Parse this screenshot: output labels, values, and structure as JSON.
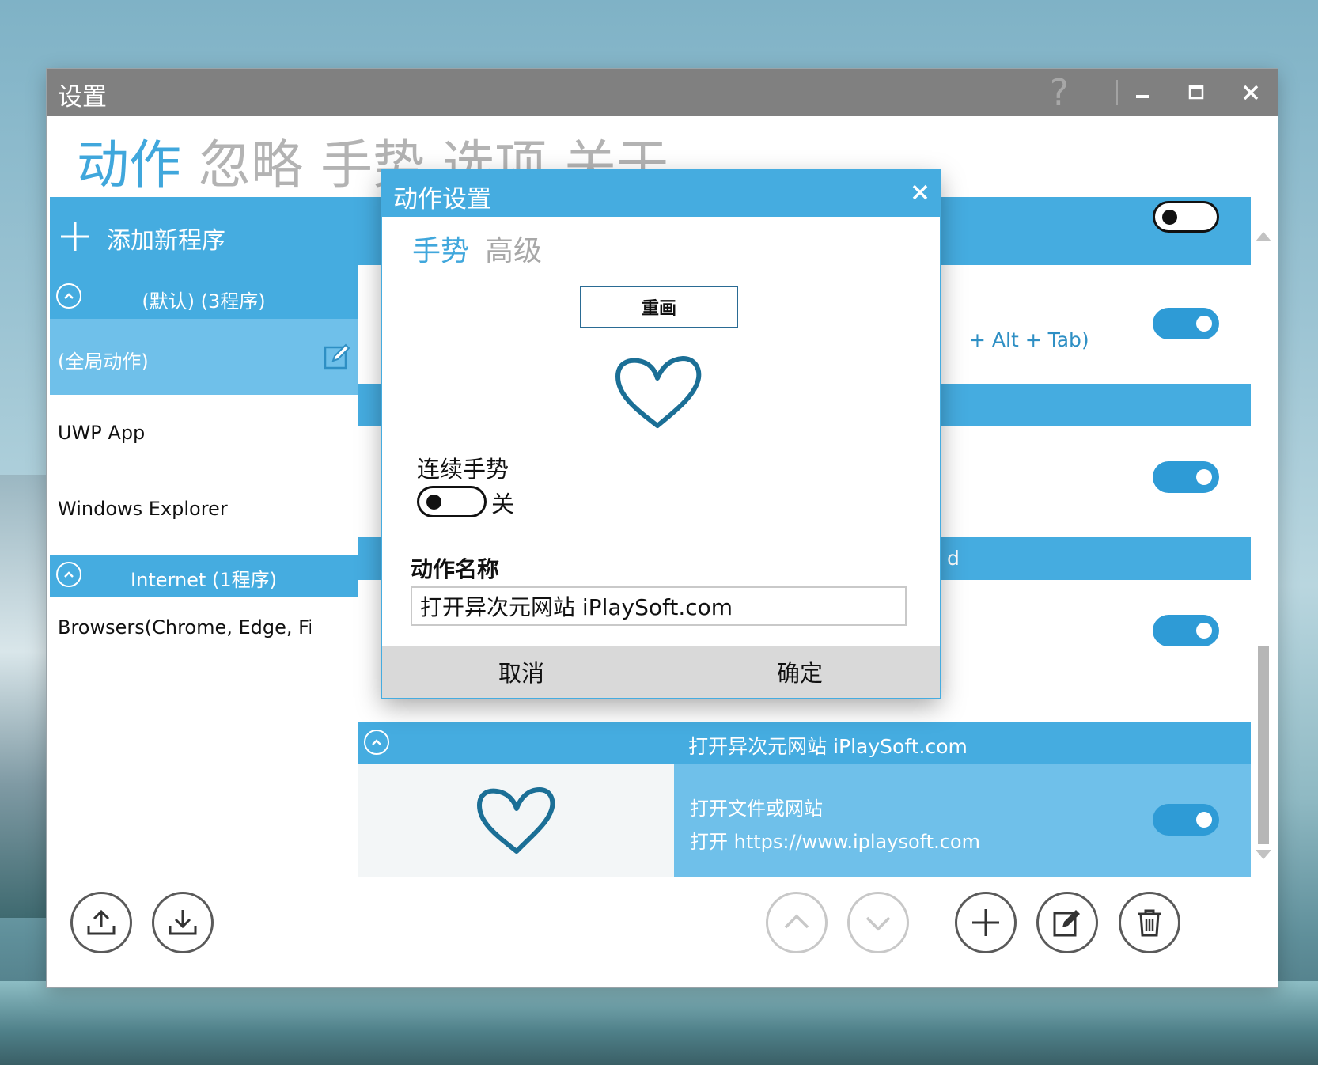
{
  "window": {
    "title": "设置",
    "help_label": "?",
    "minimize_label": "–",
    "maximize_label": "□",
    "close_label": "✕"
  },
  "tabs": [
    {
      "label": "动作",
      "active": true
    },
    {
      "label": "忽略",
      "active": false
    },
    {
      "label": "手势",
      "active": false
    },
    {
      "label": "选项",
      "active": false
    },
    {
      "label": "关于",
      "active": false
    }
  ],
  "sidebar": {
    "add_label": "添加新程序",
    "groups": [
      {
        "label": "(默认) (3程序)"
      },
      {
        "label": "Internet (1程序)"
      }
    ],
    "programs": [
      {
        "label": "(全局动作)",
        "selected": true
      },
      {
        "label": "UWP App",
        "selected": false
      },
      {
        "label": "Windows Explorer",
        "selected": false
      },
      {
        "label": "Browsers(Chrome, Edge, Firef",
        "selected": false
      }
    ]
  },
  "actions": {
    "partial_hotkey": "+ Alt + Tab)",
    "partial_group": "d",
    "last": {
      "name": "打开异次元网站 iPlaySoft.com",
      "type": "打开文件或网站",
      "detail": "打开 https://www.iplaysoft.com",
      "enabled": true
    }
  },
  "dialog": {
    "title": "动作设置",
    "close_label": "✕",
    "tabs": [
      {
        "label": "手势",
        "active": true
      },
      {
        "label": "高级",
        "active": false
      }
    ],
    "redraw_label": "重画",
    "continuous_label": "连续手势",
    "continuous_state": "关",
    "name_label": "动作名称",
    "name_value": "打开异次元网站 iPlaySoft.com",
    "cancel_label": "取消",
    "ok_label": "确定"
  },
  "colors": {
    "accent": "#45ace0",
    "accent_light": "#6fc0ea",
    "title_gray": "#808080",
    "gesture_stroke": "#1b6f96"
  },
  "icons": {
    "export": "upload-icon",
    "import": "download-icon",
    "move_up": "chevron-up-icon",
    "move_down": "chevron-down-icon",
    "add": "plus-icon",
    "edit": "edit-icon",
    "delete": "trash-icon"
  }
}
